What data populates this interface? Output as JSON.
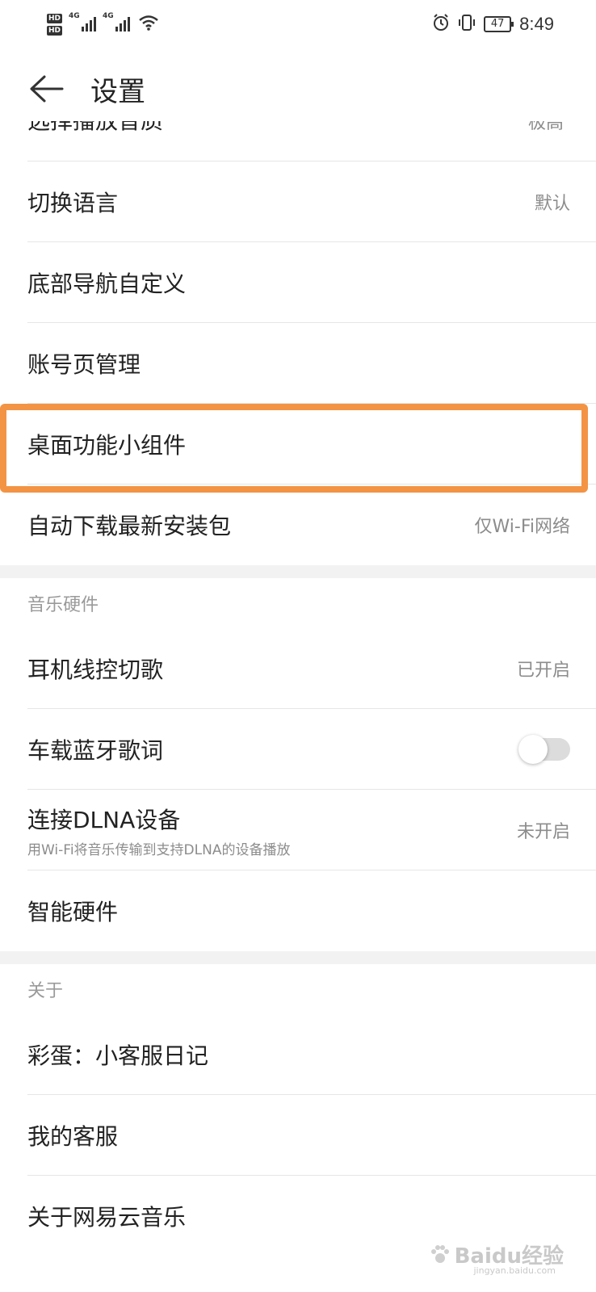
{
  "status_bar": {
    "hd1": "HD",
    "hd2": "HD",
    "net1": "4G",
    "net2": "4G",
    "battery": "47",
    "time": "8:49"
  },
  "header": {
    "title": "设置"
  },
  "partial_row": {
    "label": "选择播放音质",
    "value": "极高"
  },
  "top_rows": [
    {
      "label": "切换语言",
      "value": "默认"
    },
    {
      "label": "底部导航自定义",
      "value": ""
    },
    {
      "label": "账号页管理",
      "value": ""
    },
    {
      "label": "桌面功能小组件",
      "value": ""
    },
    {
      "label": "自动下载最新安装包",
      "value": "仅Wi-Fi网络"
    }
  ],
  "music_hardware": {
    "header": "音乐硬件",
    "rows": [
      {
        "label": "耳机线控切歌",
        "value": "已开启"
      },
      {
        "label": "车载蓝牙歌词",
        "toggle_on": false
      },
      {
        "label": "连接DLNA设备",
        "sub": "用Wi-Fi将音乐传输到支持DLNA的设备播放",
        "value": "未开启"
      },
      {
        "label": "智能硬件",
        "value": ""
      }
    ]
  },
  "about": {
    "header": "关于",
    "rows": [
      {
        "label": "彩蛋：小客服日记"
      },
      {
        "label": "我的客服"
      },
      {
        "label": "关于网易云音乐"
      }
    ]
  },
  "highlight_color": "#f39445",
  "watermark": {
    "brand": "Baidu经验",
    "url": "jingyan.baidu.com"
  }
}
